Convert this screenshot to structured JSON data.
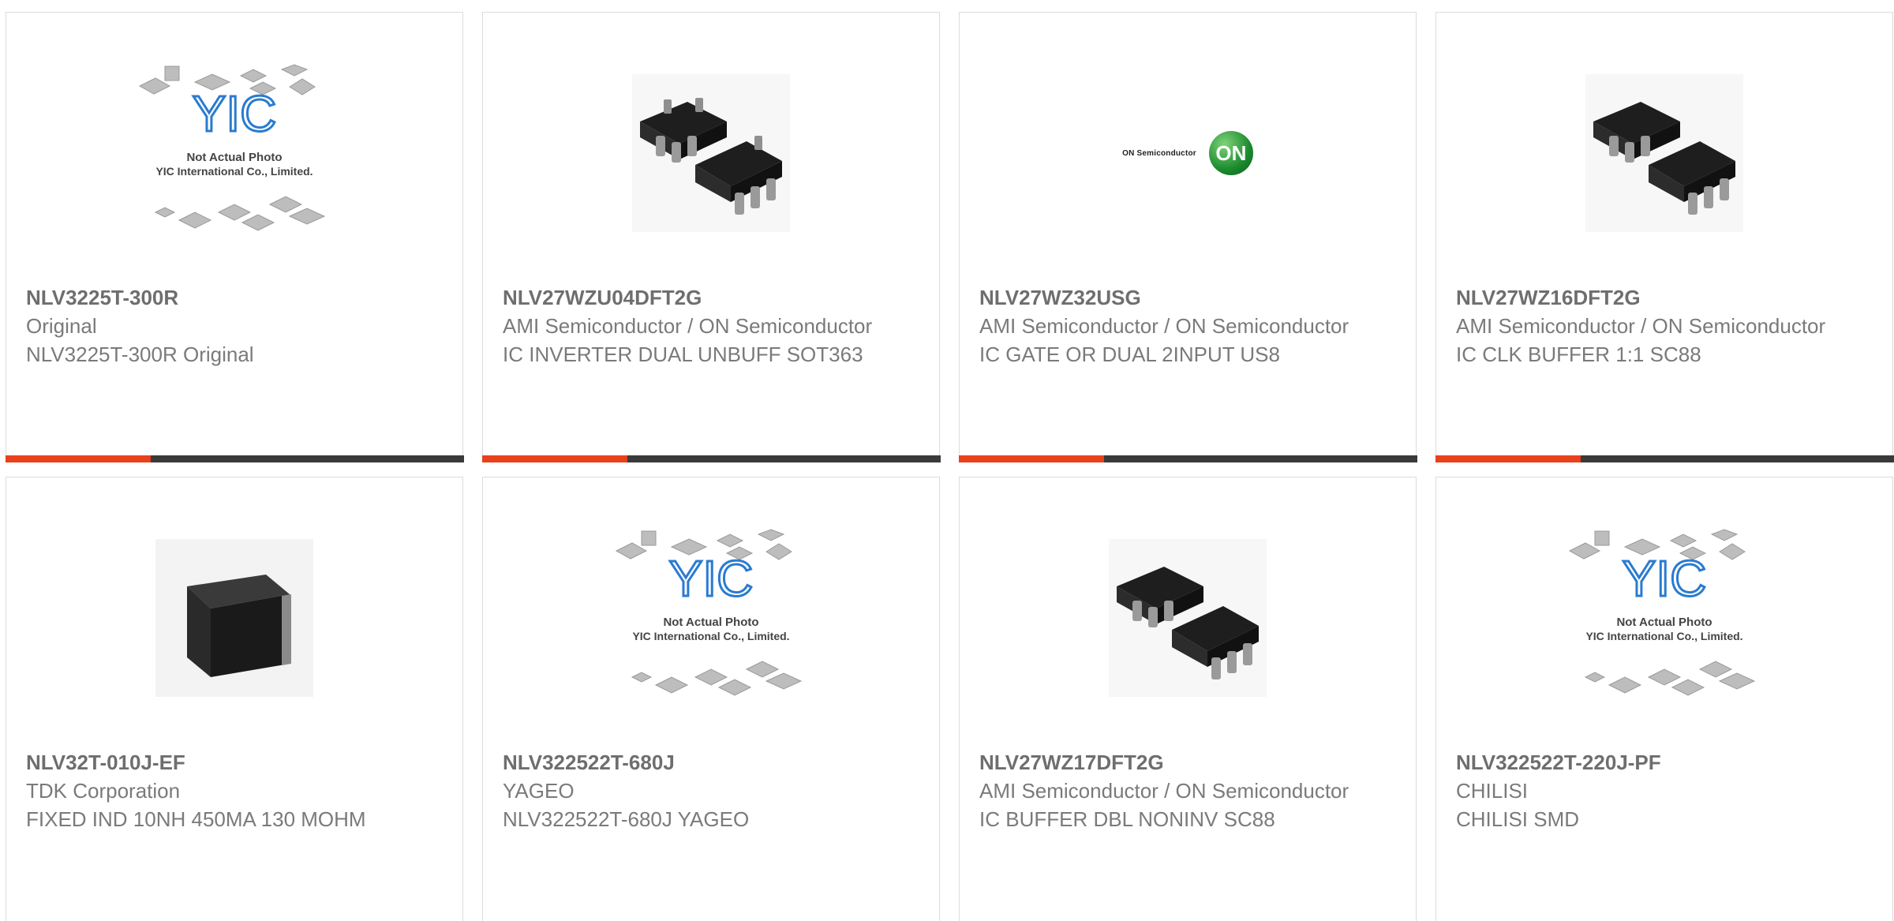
{
  "products": [
    {
      "part": "NLV3225T-300R",
      "manufacturer": "Original",
      "description": "NLV3225T-300R Original",
      "image": "not-actual-photo-placeholder"
    },
    {
      "part": "NLV27WZU04DFT2G",
      "manufacturer": "AMI Semiconductor / ON Semiconductor",
      "description": "IC INVERTER DUAL UNBUFF SOT363",
      "image": "sot363-chip-photo"
    },
    {
      "part": "NLV27WZ32USG",
      "manufacturer": "AMI Semiconductor / ON Semiconductor",
      "description": "IC GATE OR DUAL 2INPUT US8",
      "image": "on-semiconductor-logo"
    },
    {
      "part": "NLV27WZ16DFT2G",
      "manufacturer": "AMI Semiconductor / ON Semiconductor",
      "description": "IC CLK BUFFER 1:1 SC88",
      "image": "sot363-chip-photo"
    },
    {
      "part": "NLV32T-010J-EF",
      "manufacturer": "TDK Corporation",
      "description": "FIXED IND 10NH 450MA 130 MOHM",
      "image": "smd-inductor-photo"
    },
    {
      "part": "NLV322522T-680J",
      "manufacturer": "YAGEO",
      "description": "NLV322522T-680J YAGEO",
      "image": "not-actual-photo-placeholder"
    },
    {
      "part": "NLV27WZ17DFT2G",
      "manufacturer": "AMI Semiconductor / ON Semiconductor",
      "description": "IC BUFFER DBL NONINV SC88",
      "image": "sot363-chip-photo"
    },
    {
      "part": "NLV322522T-220J-PF",
      "manufacturer": "CHILISI",
      "description": "CHILISI SMD",
      "image": "not-actual-photo-placeholder"
    }
  ],
  "placeholder": {
    "line1": "Not Actual Photo",
    "line2": "YIC International Co., Limited.",
    "logo": "YIC"
  },
  "on_logo": {
    "brand": "ON Semiconductor",
    "mark": "ON"
  },
  "colors": {
    "accent": "#e8411b",
    "bar": "#3a3a3a",
    "text": "#777777",
    "border": "#dcdcdc"
  }
}
